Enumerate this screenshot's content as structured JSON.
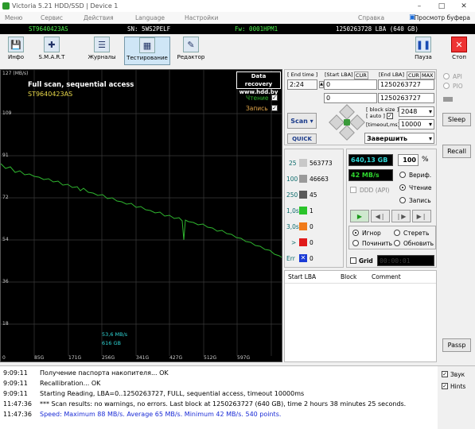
{
  "title": "Victoria 5.21 HDD/SSD | Device 1",
  "menu": [
    "Меню",
    "Сервис",
    "Действия",
    "Language",
    "Настройки",
    "Справка"
  ],
  "menu_right": "Просмотр буфера",
  "info": {
    "model": "ST9640423AS",
    "sn": "SN: 5WS2PELF",
    "fw": "Fw: 0001HPM1",
    "lba": "1250263728 LBA (640 GB)"
  },
  "toolbar": [
    "Инфо",
    "S.M.A.R.T",
    "Журналы",
    "Тестирование",
    "Редактор"
  ],
  "toolbar_right": [
    "Пауза",
    "Стоп"
  ],
  "graph": {
    "ymax": "127 (MB/s)",
    "title": "Full scan, sequential access",
    "model": "ST9640423AS",
    "brand1": "Data recovery",
    "brand2": "www.hdd.by",
    "read": "Чтение",
    "write": "Запись",
    "yticks": [
      "109",
      "91",
      "72",
      "54",
      "36",
      "18"
    ],
    "xticks": [
      "0",
      "85G",
      "171G",
      "256G",
      "341G",
      "427G",
      "512G",
      "597G"
    ],
    "speed": "53,6 MB/s",
    "pos": "616 GB"
  },
  "end_time": {
    "label": "End time",
    "value": "2:24"
  },
  "start_lba": {
    "label": "Start LBA",
    "cur": "CUR",
    "value": "0",
    "value2": "0"
  },
  "end_lba": {
    "label": "End LBA",
    "cur": "CUR",
    "max": "MAX",
    "value": "1250263727",
    "value2": "1250263727"
  },
  "scan_btn": "Scan",
  "quick_btn": "QUICK",
  "block_size": {
    "label1": "block size",
    "label2": "auto",
    "value": "2048"
  },
  "timeout": {
    "label": "timeout,ms",
    "value": "10000"
  },
  "finish": "Завершить",
  "stats": [
    {
      "ms": "25",
      "count": "563773"
    },
    {
      "ms": "100",
      "count": "46663"
    },
    {
      "ms": "250",
      "count": "45"
    },
    {
      "ms": "1,0s",
      "count": "1"
    },
    {
      "ms": "3,0s",
      "count": "0"
    },
    {
      "ms": ">",
      "count": "0"
    },
    {
      "ms": "Err",
      "count": "0"
    }
  ],
  "progress": {
    "size": "640,13 GB",
    "percent": "100",
    "pct_sign": "%",
    "speed": "42 MB/s"
  },
  "mode": {
    "verify": "Вериф.",
    "read": "Чтение",
    "write": "Запись"
  },
  "ddd": "DDD (API)",
  "actions": {
    "ignore": "Игнор",
    "erase": "Стереть",
    "restore": "Починить",
    "update": "Обновить"
  },
  "grid": "Grid",
  "timer": "00:00:01",
  "table_headers": [
    "Start LBA",
    "Block",
    "Comment"
  ],
  "side": {
    "api": "API",
    "pio": "PIO",
    "sleep": "Sleep",
    "recall": "Recall",
    "passp": "Passp",
    "sound": "Звук",
    "hints": "Hints"
  },
  "log": [
    {
      "time": "9:09:11",
      "text": "Получение паспорта накопителя... OK",
      "color": "#000000"
    },
    {
      "time": "9:09:11",
      "text": "Recallibration... OK",
      "color": "#000000"
    },
    {
      "time": "9:09:11",
      "text": "Starting Reading, LBA=0..1250263727, FULL, sequential access, timeout 10000ms",
      "color": "#000000"
    },
    {
      "time": "11:47:36",
      "text": "*** Scan results: no warnings, no errors. Last block at 1250263727 (640 GB), time 2 hours 38 minutes 25 seconds.",
      "color": "#000000"
    },
    {
      "time": "11:47:36",
      "text": "Speed: Maximum 88 MB/s. Average 65 MB/s. Minimum 42 MB/s. 540 points.",
      "color": "#1a2bd6"
    }
  ]
}
